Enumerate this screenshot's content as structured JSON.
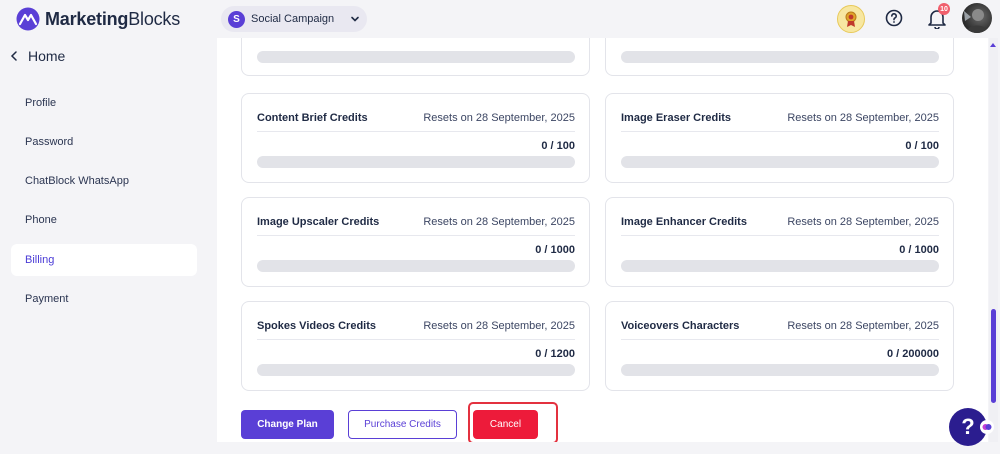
{
  "header": {
    "logo_bold": "Marketing",
    "logo_rest": "Blocks",
    "workspace_initial": "S",
    "workspace_name": "Social Campaign",
    "notification_count": "10",
    "icons": {
      "award": "award-icon",
      "help": "help-circle-icon",
      "bell": "bell-icon"
    }
  },
  "sidebar": {
    "back_label": "Home",
    "items": [
      {
        "label": "Profile"
      },
      {
        "label": "Password"
      },
      {
        "label": "ChatBlock WhatsApp"
      },
      {
        "label": "Phone"
      },
      {
        "label": "Billing",
        "active": true
      },
      {
        "label": "Payment"
      }
    ]
  },
  "credits": [
    {
      "title": "Content Brief Credits",
      "reset": "Resets on 28 September, 2025",
      "usage": "0 / 100",
      "fraction": 0
    },
    {
      "title": "Image Eraser Credits",
      "reset": "Resets on 28 September, 2025",
      "usage": "0 / 100",
      "fraction": 0
    },
    {
      "title": "Image Upscaler Credits",
      "reset": "Resets on 28 September, 2025",
      "usage": "0 / 1000",
      "fraction": 0
    },
    {
      "title": "Image Enhancer Credits",
      "reset": "Resets on 28 September, 2025",
      "usage": "0 / 1000",
      "fraction": 0
    },
    {
      "title": "Spokes Videos Credits",
      "reset": "Resets on 28 September, 2025",
      "usage": "0 / 1200",
      "fraction": 0
    },
    {
      "title": "Voiceovers Characters",
      "reset": "Resets on 28 September, 2025",
      "usage": "0 / 200000",
      "fraction": 0
    }
  ],
  "actions": {
    "change_plan": "Change Plan",
    "purchase_credits": "Purchase Credits",
    "cancel": "Cancel"
  },
  "colors": {
    "accent": "#5a3fd6",
    "danger": "#ed1b3a",
    "highlight": "#e3313f"
  },
  "floating_help": "?"
}
